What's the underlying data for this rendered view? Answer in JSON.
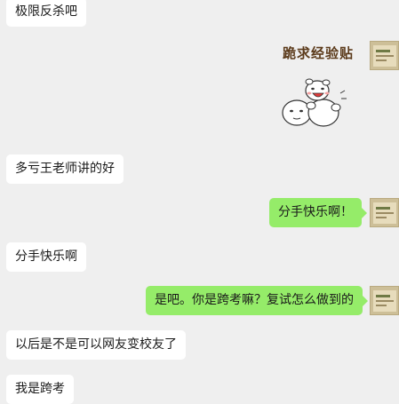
{
  "messages": [
    {
      "side": "in",
      "text": "极限反杀吧"
    },
    {
      "side": "out",
      "type": "sticker",
      "text": "跪求经验贴"
    },
    {
      "side": "in",
      "text": "多亏王老师讲的好"
    },
    {
      "side": "out",
      "text": "分手快乐啊！"
    },
    {
      "side": "in",
      "text": "分手快乐啊"
    },
    {
      "side": "out",
      "text": "是吧。你是跨考嘛？复试怎么做到的"
    },
    {
      "side": "in",
      "text": "以后是不是可以网友变校友了"
    },
    {
      "side": "in",
      "text": "我是跨考"
    }
  ],
  "colors": {
    "background": "#efefef",
    "incoming_bubble": "#ffffff",
    "outgoing_bubble": "#95ec69",
    "sticker_text": "#5b3a1a"
  },
  "icons": {
    "avatar": "user-avatar-icon",
    "sticker": "cartoon-sticker-icon"
  }
}
